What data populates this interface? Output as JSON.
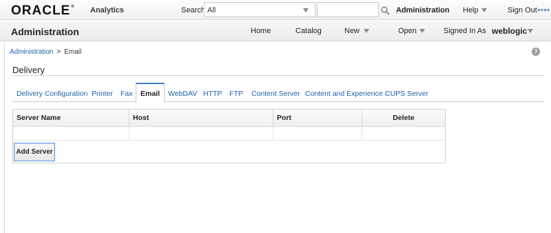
{
  "app": {
    "brand": "ORACLE",
    "product": "Analytics"
  },
  "topbar": {
    "search_label": "Search",
    "search_scope": "All",
    "search_text": "",
    "administration": "Administration",
    "help": "Help",
    "sign_out": "Sign Out"
  },
  "header": {
    "title": "Administration",
    "nav": {
      "home": "Home",
      "catalog": "Catalog",
      "new": "New",
      "open": "Open"
    },
    "signed_in_as": "Signed In As",
    "user": "weblogic"
  },
  "breadcrumb": {
    "parent": "Administration",
    "separator": ">",
    "current": "Email"
  },
  "section": {
    "title": "Delivery"
  },
  "tabs": [
    {
      "label": "Delivery Configuration"
    },
    {
      "label": "Printer"
    },
    {
      "label": "Fax"
    },
    {
      "label": "Email"
    },
    {
      "label": "WebDAV"
    },
    {
      "label": "HTTP"
    },
    {
      "label": "FTP"
    },
    {
      "label": "Content Server"
    },
    {
      "label": "Content and Experience"
    },
    {
      "label": "CUPS Server"
    }
  ],
  "active_tab": "Email",
  "grid": {
    "columns": [
      "Server Name",
      "Host",
      "Port",
      "Delete"
    ],
    "add_button": "Add Server"
  },
  "colors": {
    "link": "#1a5fa8",
    "active_tab_accent": "#3a7ec9",
    "button_border": "#6f9fd8"
  }
}
